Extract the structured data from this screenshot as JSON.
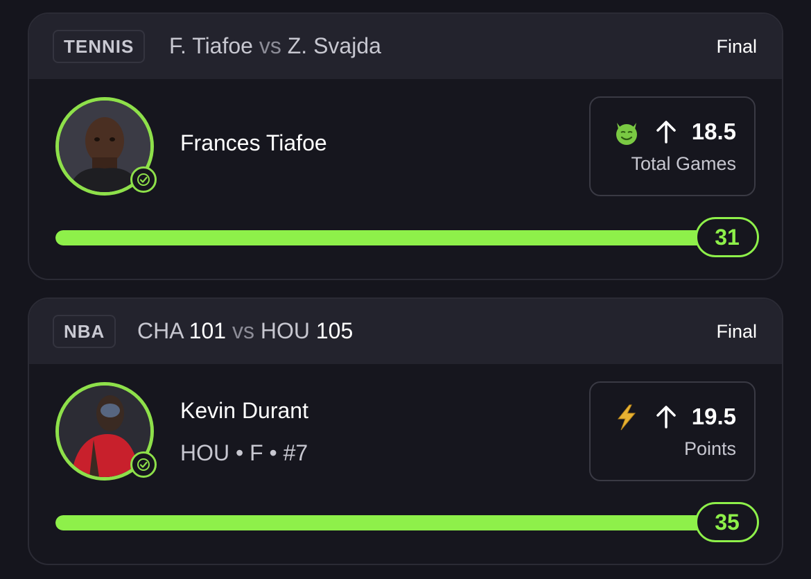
{
  "cards": [
    {
      "league": "TENNIS",
      "matchup": {
        "team1": "F. Tiafoe",
        "score1": "",
        "vs": "vs",
        "team2": "Z. Svajda",
        "score2": ""
      },
      "status": "Final",
      "player": {
        "name": "Frances Tiafoe",
        "meta": ""
      },
      "pick": {
        "icon": "devil-emoji-icon",
        "direction": "up-arrow-icon",
        "line": "18.5",
        "stat": "Total Games"
      },
      "result": "31",
      "progress_fraction": 1.0,
      "colors": {
        "accent": "#8ef04a"
      }
    },
    {
      "league": "NBA",
      "matchup": {
        "team1": "CHA",
        "score1": "101",
        "vs": "vs",
        "team2": "HOU",
        "score2": "105"
      },
      "status": "Final",
      "player": {
        "name": "Kevin Durant",
        "meta": "HOU • F • #7"
      },
      "pick": {
        "icon": "lightning-icon",
        "direction": "up-arrow-icon",
        "line": "19.5",
        "stat": "Points"
      },
      "result": "35",
      "progress_fraction": 1.0,
      "colors": {
        "accent": "#8ef04a"
      }
    }
  ]
}
